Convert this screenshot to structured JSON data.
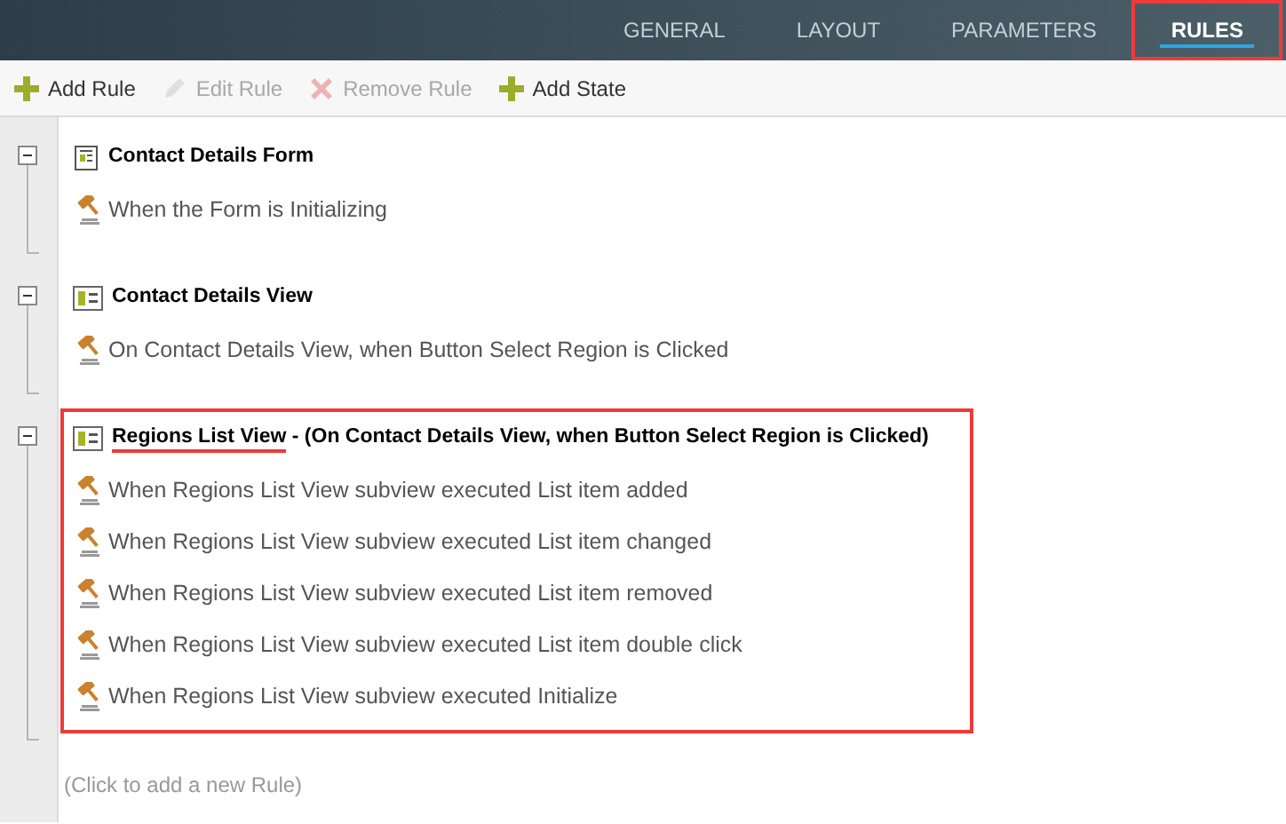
{
  "tabs": [
    {
      "label": "GENERAL",
      "selected": false
    },
    {
      "label": "LAYOUT",
      "selected": false
    },
    {
      "label": "PARAMETERS",
      "selected": false
    },
    {
      "label": "RULES",
      "selected": true,
      "highlighted": true
    }
  ],
  "toolbar": [
    {
      "label": "Add Rule",
      "kind": "add",
      "disabled": false
    },
    {
      "label": "Edit Rule",
      "kind": "edit",
      "disabled": true
    },
    {
      "label": "Remove Rule",
      "kind": "remove",
      "disabled": true
    },
    {
      "label": "Add State",
      "kind": "add",
      "disabled": false
    }
  ],
  "groups": [
    {
      "kind": "form",
      "name": "Contact Details Form",
      "expanded": true,
      "highlighted": false,
      "rules": [
        "When the Form is Initializing"
      ]
    },
    {
      "kind": "view",
      "name": "Contact Details View",
      "expanded": true,
      "highlighted": false,
      "rules": [
        "On Contact Details View, when Button Select Region is Clicked"
      ]
    },
    {
      "kind": "view",
      "name": "Regions List View",
      "name_underlined": true,
      "context": " - (On Contact Details View, when Button Select Region is Clicked)",
      "expanded": true,
      "highlighted": true,
      "rules": [
        "When Regions List View subview executed List item added",
        "When Regions List View subview executed List item changed",
        "When Regions List View subview executed List item removed",
        "When Regions List View subview executed List item double click",
        "When Regions List View subview executed Initialize"
      ]
    }
  ],
  "add_rule_hint": "(Click to add a new Rule)"
}
